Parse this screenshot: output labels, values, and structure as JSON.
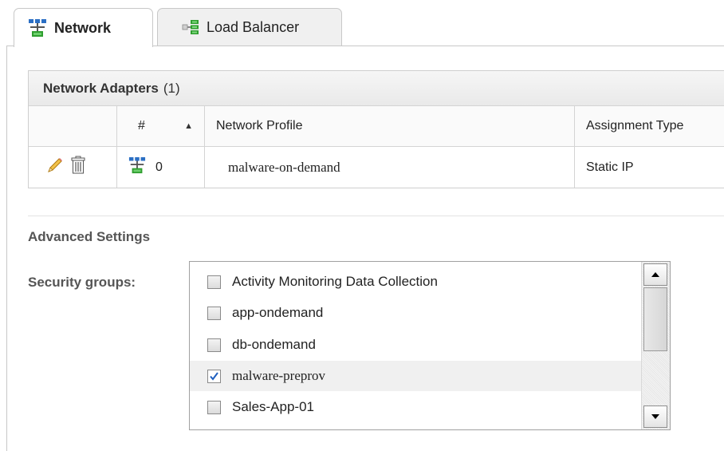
{
  "tabs": [
    {
      "label": "Network",
      "icon": "network-icon",
      "active": true
    },
    {
      "label": "Load Balancer",
      "icon": "load-balancer-icon",
      "active": false
    }
  ],
  "adapters": {
    "title": "Network Adapters",
    "count": "(1)",
    "columns": {
      "index": "#",
      "profile": "Network Profile",
      "assignment": "Assignment Type"
    },
    "rows": [
      {
        "index": "0",
        "profile": "malware-on-demand",
        "assignment": "Static IP"
      }
    ]
  },
  "advanced": {
    "title": "Advanced Settings",
    "security_label": "Security groups:",
    "security_groups": [
      {
        "label": "Activity Monitoring Data Collection",
        "checked": false
      },
      {
        "label": "app-ondemand",
        "checked": false
      },
      {
        "label": "db-ondemand",
        "checked": false
      },
      {
        "label": "malware-preprov",
        "checked": true
      },
      {
        "label": "Sales-App-01",
        "checked": false
      }
    ]
  },
  "colors": {
    "accent_check": "#1e5fbf",
    "border": "#c8c8c8",
    "icon_green": "#2f9e2f",
    "icon_blue": "#2b6fc4"
  }
}
